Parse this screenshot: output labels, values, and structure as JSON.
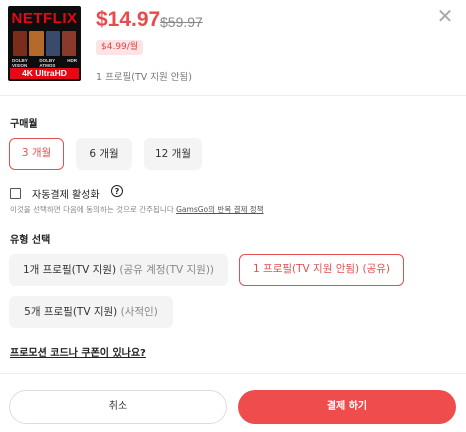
{
  "product": {
    "thumb_brand": "NETFLIX",
    "thumb_logos": [
      "DOLBY VISION",
      "DOLBY ATMOS",
      "HDR"
    ],
    "thumb_badge": "4K UltraHD",
    "price": "$14.97",
    "old_price": "$59.97",
    "per_month": "$4.99/월",
    "profile_note": "1 프로필(TV 지원 안됨)"
  },
  "period": {
    "title": "구매월",
    "options": [
      "3 개월",
      "6 개월",
      "12 개월"
    ],
    "selected_index": 0
  },
  "auto_renew": {
    "label": "자동결제 활성화",
    "help_icon": "?",
    "checked": false,
    "terms_prefix": "이것을 선택하면 다음에 동의하는 것으로 간주됩니다 ",
    "terms_link": "GamsGo의 반복 결제 정책"
  },
  "type": {
    "title": "유형 선택",
    "options": [
      {
        "main": "1개 프로필(TV 지원)",
        "sub": "(공유 계정(TV 지원))"
      },
      {
        "main": "1 프로필(TV 지원 안됨)",
        "sub": "(공유)"
      },
      {
        "main": "5개 프로필(TV 지원)",
        "sub": "(사적인)"
      }
    ],
    "selected_index": 1
  },
  "promo_link": "프로모션 코드나 쿠폰이 있나요?",
  "buttons": {
    "cancel": "취소",
    "pay": "결제 하기"
  },
  "colors": {
    "accent": "#ef4d4d",
    "netflix": "#e50914"
  },
  "icons": {
    "close": "close-icon",
    "help": "question-circle-icon",
    "checkbox": "checkbox-icon"
  }
}
